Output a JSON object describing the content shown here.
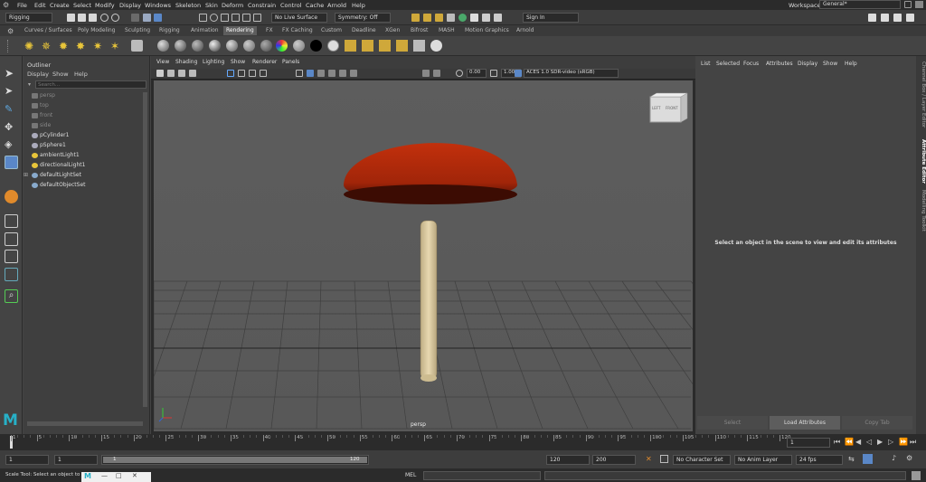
{
  "menubar": {
    "items": [
      "File",
      "Edit",
      "Create",
      "Select",
      "Modify",
      "Display",
      "Windows",
      "Skeleton",
      "Skin",
      "Deform",
      "Constrain",
      "Control",
      "Cache",
      "Arnold",
      "Help"
    ],
    "workspace_label": "Workspace:",
    "workspace_value": "General*"
  },
  "statusline": {
    "mode": "Rigging",
    "live_surface": "No Live Surface",
    "symmetry": "Symmetry: Off",
    "sign_in": "Sign In"
  },
  "shelf": {
    "tabs": [
      "Curves / Surfaces",
      "Poly Modeling",
      "Sculpting",
      "Rigging",
      "Animation",
      "Rendering",
      "FX",
      "FX Caching",
      "Custom",
      "Deadline",
      "XGen",
      "Bifrost",
      "MASH",
      "Motion Graphics",
      "Arnold"
    ],
    "active_tab": "Rendering"
  },
  "outliner": {
    "title": "Outliner",
    "menu": [
      "Display",
      "Show",
      "Help"
    ],
    "search_placeholder": "Search...",
    "items": [
      {
        "label": "persp",
        "dim": true
      },
      {
        "label": "top",
        "dim": true
      },
      {
        "label": "front",
        "dim": true
      },
      {
        "label": "side",
        "dim": true
      },
      {
        "label": "pCylinder1",
        "dim": false
      },
      {
        "label": "pSphere1",
        "dim": false
      },
      {
        "label": "ambientLight1",
        "dim": false
      },
      {
        "label": "directionalLight1",
        "dim": false
      },
      {
        "label": "defaultLightSet",
        "dim": false
      },
      {
        "label": "defaultObjectSet",
        "dim": false
      }
    ]
  },
  "viewport": {
    "menu": [
      "View",
      "Shading",
      "Lighting",
      "Show",
      "Renderer",
      "Panels"
    ],
    "exposure": "0.00",
    "gamma": "1.00",
    "color_space": "ACES 1.0 SDR-video (sRGB)",
    "camera_label": "persp",
    "cube_left": "LEFT",
    "cube_front": "FRONT"
  },
  "attribute_editor": {
    "menu": [
      "List",
      "Selected",
      "Focus",
      "Attributes",
      "Display",
      "Show",
      "Help"
    ],
    "message": "Select an object in the scene to view and edit its attributes",
    "buttons": [
      "Select",
      "Load Attributes",
      "Copy Tab"
    ]
  },
  "side_tabs": [
    "Channel Box / Layer Editor",
    "Attribute Editor",
    "Modelling Toolkit"
  ],
  "timeline": {
    "ticks": [
      "1",
      "5",
      "10",
      "15",
      "20",
      "25",
      "30",
      "35",
      "40",
      "45",
      "50",
      "55",
      "60",
      "65",
      "70",
      "75",
      "80",
      "85",
      "90",
      "95",
      "100",
      "105",
      "110",
      "115",
      "120"
    ],
    "current_frame": "1"
  },
  "range": {
    "start": "1",
    "start_inner": "1",
    "range_start_label": "1",
    "range_end_label": "120",
    "end_inner": "120",
    "end": "200",
    "character_set": "No Character Set",
    "anim_layer": "No Anim Layer",
    "fps": "24 fps"
  },
  "cmdline": {
    "help_text": "Scale Tool: Select an object to",
    "mel_label": "MEL"
  }
}
